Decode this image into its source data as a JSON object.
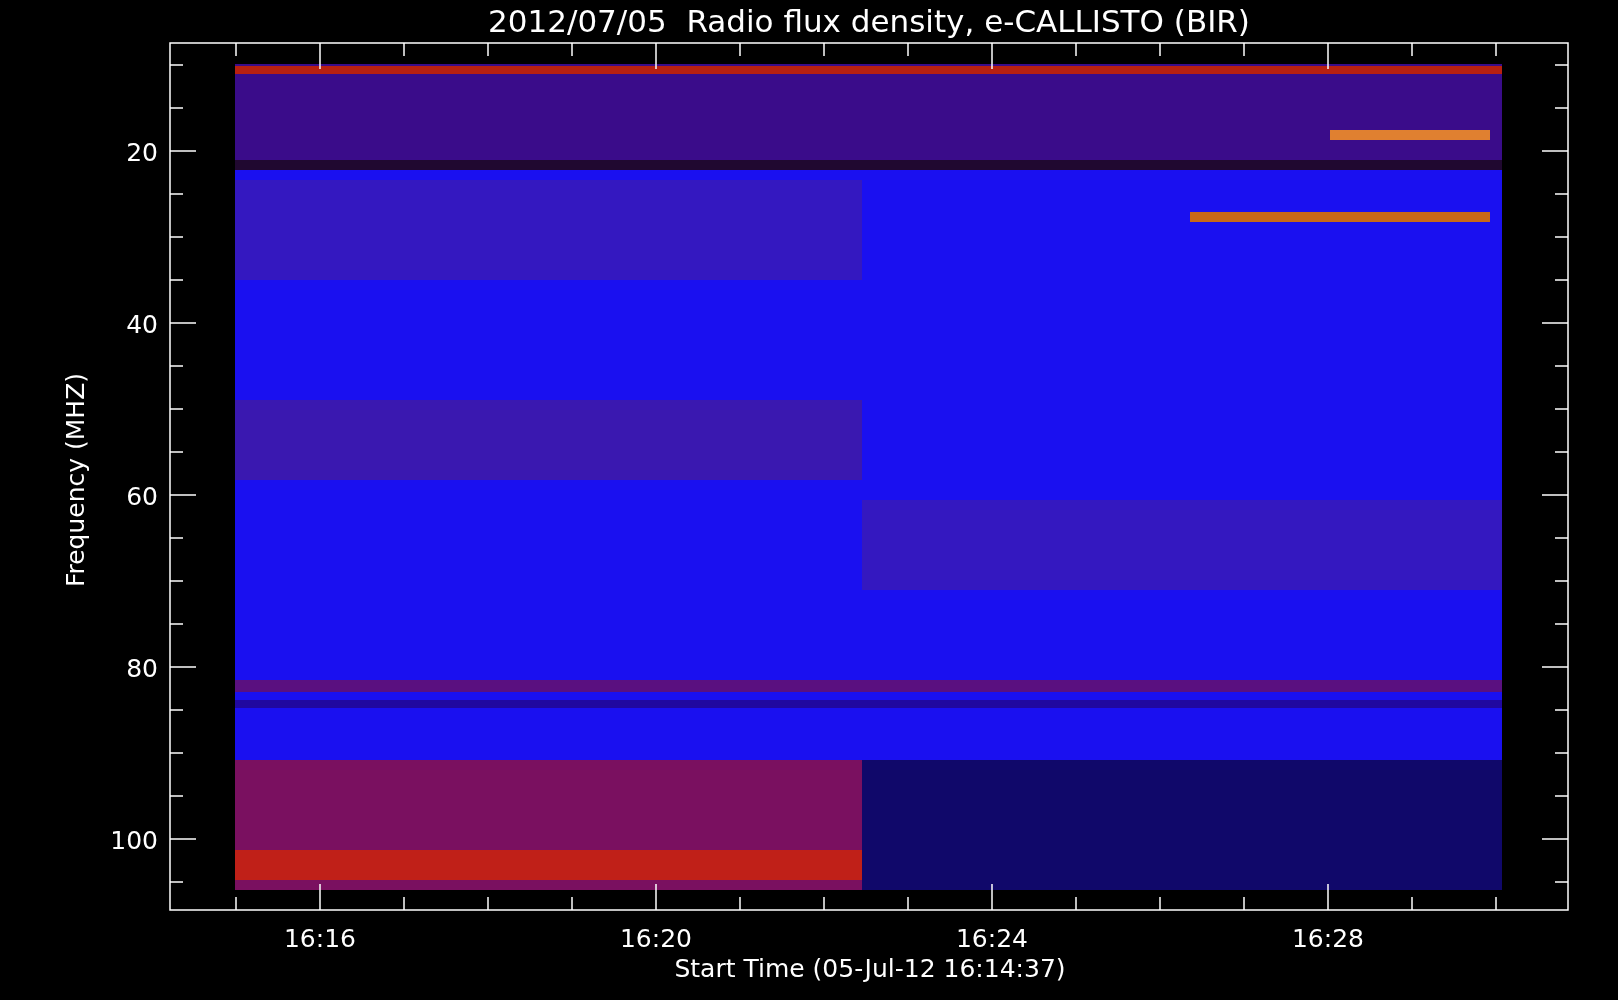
{
  "title": "2012/07/05  Radio flux density, e-CALLISTO (BIR)",
  "y_axis": {
    "label": "Frequency (MHZ)",
    "ticks": [
      "20",
      "40",
      "60",
      "80",
      "100"
    ]
  },
  "x_axis": {
    "label": "Start Time (05-Jul-12 16:14:37)",
    "ticks": [
      "16:16",
      "16:20",
      "16:24",
      "16:28"
    ]
  }
}
